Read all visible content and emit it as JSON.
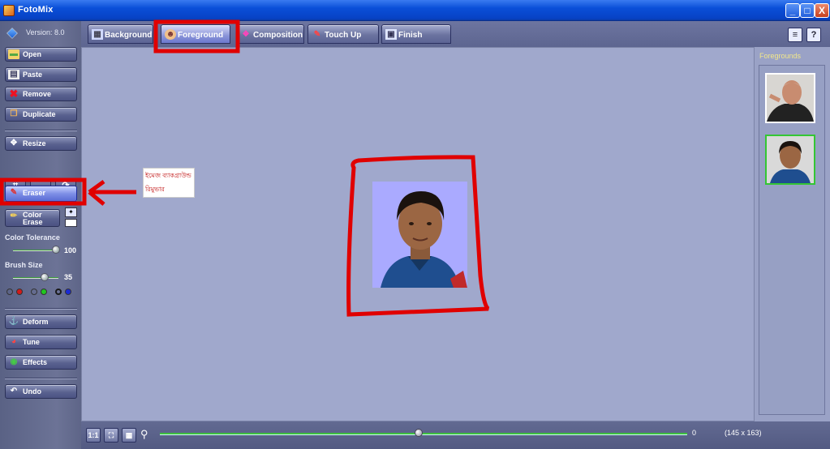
{
  "window": {
    "title": "FotoMix",
    "controls": [
      "_",
      "□",
      "X"
    ]
  },
  "sidebar": {
    "version": "Version: 8.0",
    "buttons": {
      "open": "Open",
      "paste": "Paste",
      "remove": "Remove",
      "duplicate": "Duplicate",
      "resize": "Resize",
      "eraser": "Eraser",
      "color_erase": "Color Erase",
      "deform": "Deform",
      "tune": "Tune",
      "effects": "Effects",
      "undo": "Undo"
    },
    "color_tolerance": {
      "label": "Color Tolerance",
      "value": "100"
    },
    "brush_size": {
      "label": "Brush Size",
      "value": "35"
    },
    "brush_colors": [
      "#ffffff",
      "#d21a1a",
      "#ffffff",
      "#20c820",
      "#ffffff",
      "#1a2ad6"
    ]
  },
  "tabs": [
    {
      "label": "Background",
      "icon": "landscape-icon"
    },
    {
      "label": "Foreground",
      "icon": "portrait-icon",
      "active": true
    },
    {
      "label": "Composition",
      "icon": "composition-icon"
    },
    {
      "label": "Touch Up",
      "icon": "brush-icon"
    },
    {
      "label": "Finish",
      "icon": "disk-icon"
    }
  ],
  "header_right": {
    "flag": "flag-icon",
    "help": "?"
  },
  "foregrounds": {
    "label": "Foregrounds",
    "count": 2,
    "selected": 2
  },
  "annotation": {
    "line1": "ইমেজ ব্যাকগ্রাউন্ড",
    "line2": "রিমুভার"
  },
  "bottom": {
    "zoom_value": "0",
    "dimensions": "(145 x 163)",
    "zoom_position": 0.49
  },
  "colors": {
    "accent_active": "#7e8fe6",
    "canvas": "#a0a8cc",
    "annotation_red": "#e00000",
    "selection_green": "#34c634"
  }
}
